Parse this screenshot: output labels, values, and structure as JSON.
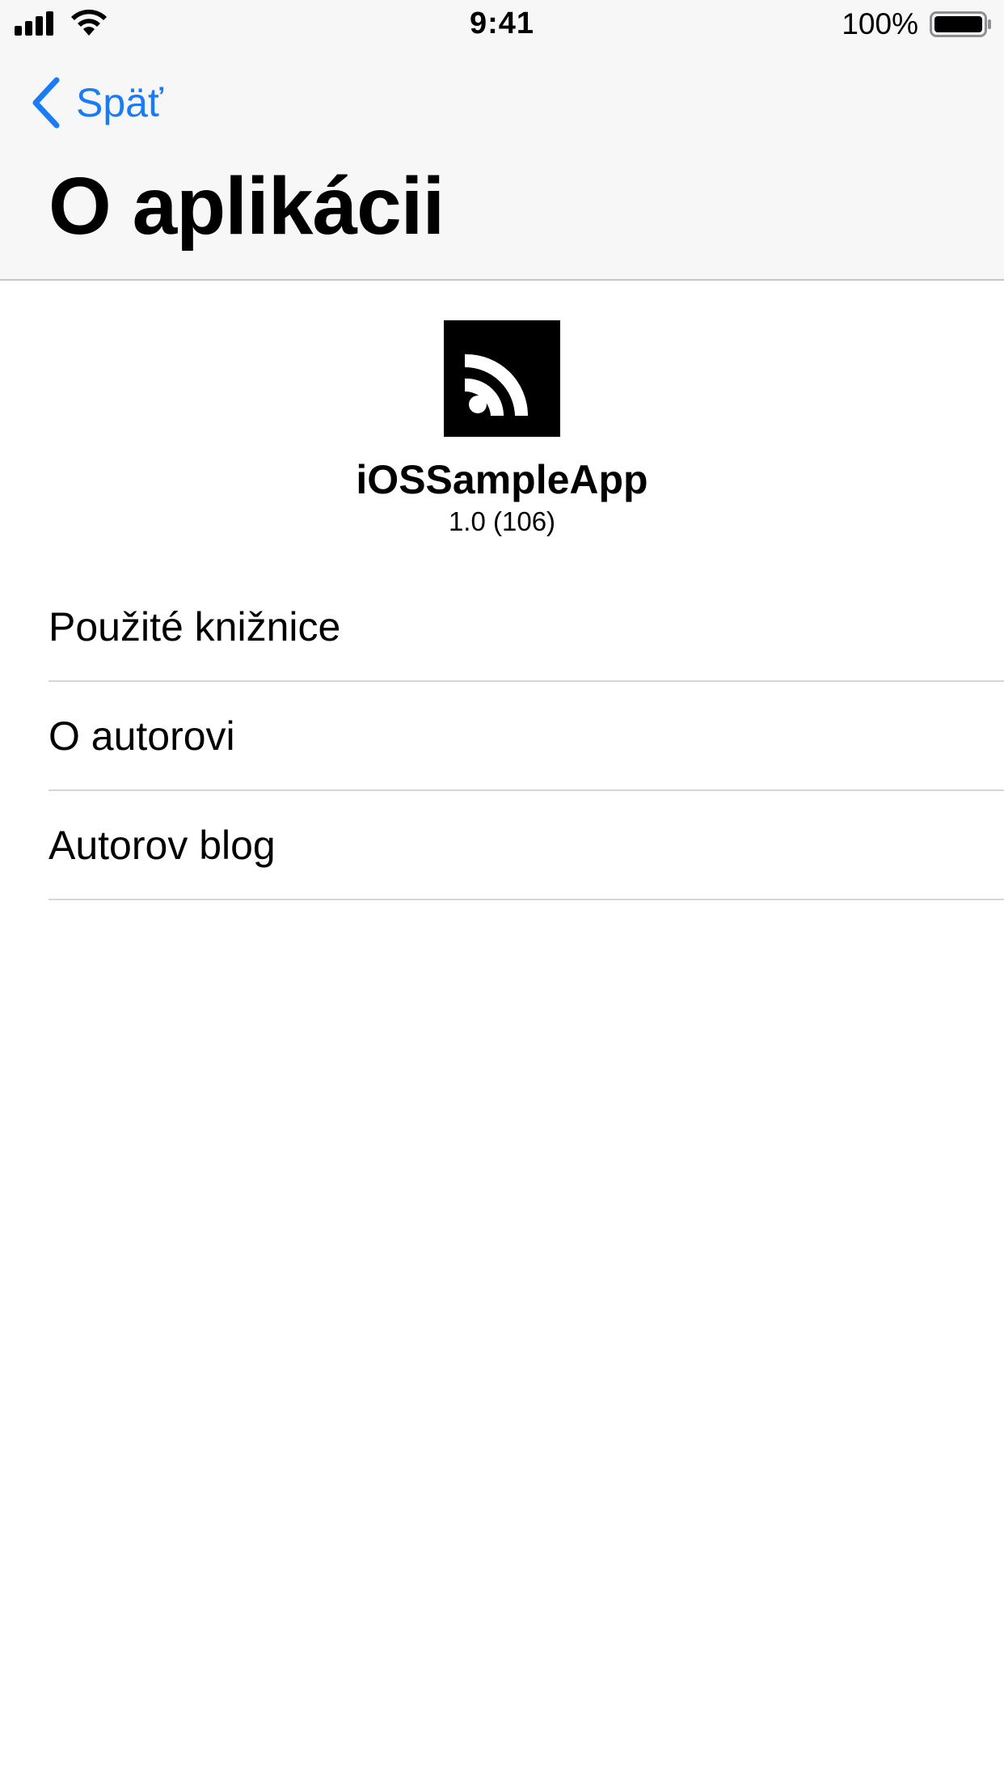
{
  "status_bar": {
    "time": "9:41",
    "battery_percent": "100%",
    "icons": [
      "signal-icon",
      "wifi-icon",
      "battery-icon"
    ]
  },
  "nav": {
    "back_label": "Späť",
    "title": "O aplikácii",
    "accent_color": "#1a7cf5"
  },
  "app": {
    "icon": "rss-feed-icon",
    "name": "iOSSampleApp",
    "version": "1.0 (106)"
  },
  "menu": {
    "items": [
      {
        "label": "Použité knižnice"
      },
      {
        "label": "O autorovi"
      },
      {
        "label": "Autorov blog"
      }
    ]
  }
}
